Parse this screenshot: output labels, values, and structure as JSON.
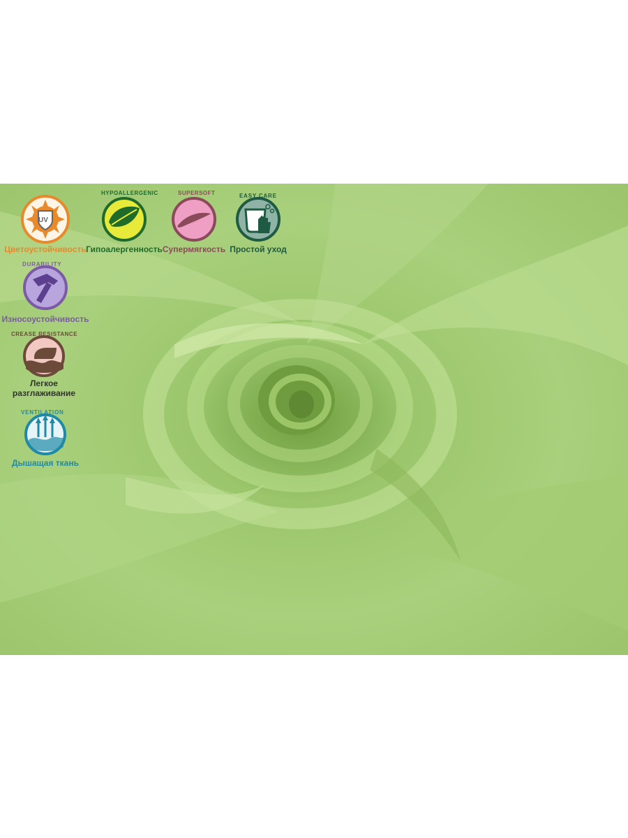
{
  "features": [
    {
      "arc_text": "",
      "label": "Цветоустойчивость",
      "color": "#e8892b",
      "icon": "uv-sun-icon",
      "badge_text": "UV"
    },
    {
      "arc_text": "HYPOALLERGENIC",
      "label": "Гипоалергенность",
      "color": "#1e6b2a",
      "icon": "leaf-icon"
    },
    {
      "arc_text": "SUPERSOFT",
      "label": "Супермягкость",
      "color": "#8a4a5a",
      "icon": "feather-icon"
    },
    {
      "arc_text": "EASY CARE",
      "label": "Простой уход",
      "color": "#1f5a42",
      "icon": "wash-hand-icon"
    },
    {
      "arc_text": "DURABILITY",
      "label": "Износоустойчивость",
      "color": "#7b5ba6",
      "icon": "hammer-icon"
    },
    {
      "arc_text": "CREASE RESISTANCE",
      "label_line1": "Легкое",
      "label_line2": "разглаживание",
      "color": "#6b4a3a",
      "icon": "iron-icon"
    },
    {
      "arc_text": "VENTILATION",
      "label": "Дышащая ткань",
      "color": "#1f8aa6",
      "icon": "ventilation-icon"
    }
  ],
  "colors": {
    "fabric": "#a8cf7a",
    "fabric_dark": "#7fae4e",
    "fabric_light": "#c4e297"
  }
}
